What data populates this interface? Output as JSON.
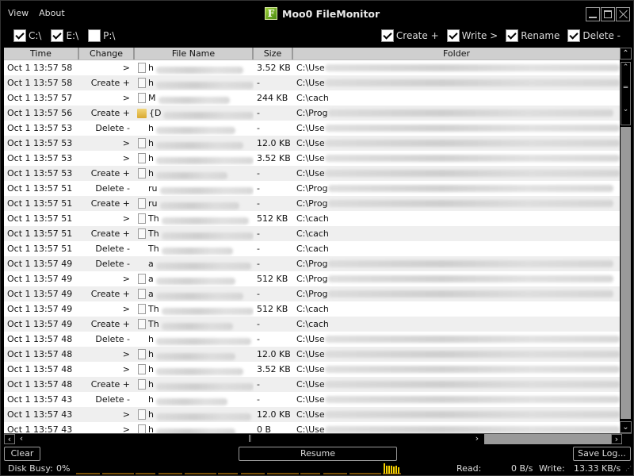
{
  "app": {
    "title": "Moo0 FileMonitor",
    "logo_letter": "F"
  },
  "menu": [
    "View",
    "About"
  ],
  "window_controls": [
    "minimize",
    "maximize",
    "close"
  ],
  "drives": [
    {
      "label": "C:\\",
      "checked": true
    },
    {
      "label": "E:\\",
      "checked": true
    },
    {
      "label": "P:\\",
      "checked": false
    }
  ],
  "event_filters": [
    {
      "label": "Create +",
      "checked": true
    },
    {
      "label": "Write >",
      "checked": true
    },
    {
      "label": "Rename",
      "checked": true
    },
    {
      "label": "Delete -",
      "checked": true
    }
  ],
  "table": {
    "columns": [
      "Time",
      "Change",
      "File Name",
      "Size",
      "Folder"
    ],
    "rows": [
      {
        "time": "Oct 1  13:57 58",
        "change": ">",
        "icon": "file",
        "name": "h",
        "size": "3.52 KB",
        "folder": "C:\\Use"
      },
      {
        "time": "Oct 1  13:57 58",
        "change": "Create +",
        "icon": "file",
        "name": "h",
        "size": "-",
        "folder": "C:\\Use"
      },
      {
        "time": "Oct 1  13:57 57",
        "change": ">",
        "icon": "file",
        "name": "M",
        "size": "244 KB",
        "folder": "C:\\cach"
      },
      {
        "time": "Oct 1  13:57 56",
        "change": "Create +",
        "icon": "folder",
        "name": "{D",
        "size": "-",
        "folder": "C:\\Prog"
      },
      {
        "time": "Oct 1  13:57 53",
        "change": "Delete -",
        "icon": "none",
        "name": "h",
        "size": "-",
        "folder": "C:\\Use"
      },
      {
        "time": "Oct 1  13:57 53",
        "change": ">",
        "icon": "file",
        "name": "h",
        "size": "12.0 KB",
        "folder": "C:\\Use"
      },
      {
        "time": "Oct 1  13:57 53",
        "change": ">",
        "icon": "file",
        "name": "h",
        "size": "3.52 KB",
        "folder": "C:\\Use"
      },
      {
        "time": "Oct 1  13:57 53",
        "change": "Create +",
        "icon": "file",
        "name": "h",
        "size": "-",
        "folder": "C:\\Use"
      },
      {
        "time": "Oct 1  13:57 51",
        "change": "Delete -",
        "icon": "none",
        "name": "ru",
        "size": "-",
        "folder": "C:\\Prog"
      },
      {
        "time": "Oct 1  13:57 51",
        "change": "Create +",
        "icon": "file",
        "name": "ru",
        "size": "-",
        "folder": "C:\\Prog"
      },
      {
        "time": "Oct 1  13:57 51",
        "change": ">",
        "icon": "file",
        "name": "Th",
        "size": "512 KB",
        "folder": "C:\\cach"
      },
      {
        "time": "Oct 1  13:57 51",
        "change": "Create +",
        "icon": "file",
        "name": "Th",
        "size": "-",
        "folder": "C:\\cach"
      },
      {
        "time": "Oct 1  13:57 51",
        "change": "Delete -",
        "icon": "none",
        "name": "Th",
        "size": "-",
        "folder": "C:\\cach"
      },
      {
        "time": "Oct 1  13:57 49",
        "change": "Delete -",
        "icon": "none",
        "name": "a",
        "size": "-",
        "folder": "C:\\Prog"
      },
      {
        "time": "Oct 1  13:57 49",
        "change": ">",
        "icon": "file",
        "name": "a",
        "size": "512 KB",
        "folder": "C:\\Prog"
      },
      {
        "time": "Oct 1  13:57 49",
        "change": "Create +",
        "icon": "file",
        "name": "a",
        "size": "-",
        "folder": "C:\\Prog"
      },
      {
        "time": "Oct 1  13:57 49",
        "change": ">",
        "icon": "file",
        "name": "Th",
        "size": "512 KB",
        "folder": "C:\\cach"
      },
      {
        "time": "Oct 1  13:57 49",
        "change": "Create +",
        "icon": "file",
        "name": "Th",
        "size": "-",
        "folder": "C:\\cach"
      },
      {
        "time": "Oct 1  13:57 48",
        "change": "Delete -",
        "icon": "none",
        "name": "h",
        "size": "-",
        "folder": "C:\\Use"
      },
      {
        "time": "Oct 1  13:57 48",
        "change": ">",
        "icon": "file",
        "name": "h",
        "size": "12.0 KB",
        "folder": "C:\\Use"
      },
      {
        "time": "Oct 1  13:57 48",
        "change": ">",
        "icon": "file",
        "name": "h",
        "size": "3.52 KB",
        "folder": "C:\\Use"
      },
      {
        "time": "Oct 1  13:57 48",
        "change": "Create +",
        "icon": "file",
        "name": "h",
        "size": "-",
        "folder": "C:\\Use"
      },
      {
        "time": "Oct 1  13:57 43",
        "change": "Delete -",
        "icon": "none",
        "name": "h",
        "size": "-",
        "folder": "C:\\Use"
      },
      {
        "time": "Oct 1  13:57 43",
        "change": ">",
        "icon": "file",
        "name": "h",
        "size": "12.0 KB",
        "folder": "C:\\Use"
      },
      {
        "time": "Oct 1  13:57 43",
        "change": ">",
        "icon": "file",
        "name": "h",
        "size": "0 B",
        "folder": "C:\\Use"
      }
    ]
  },
  "buttons": {
    "clear": "Clear",
    "resume": "Resume",
    "save_log": "Save Log..."
  },
  "status": {
    "disk_busy_label": "Disk Busy:",
    "disk_busy_value": "0%",
    "read_label": "Read:",
    "read_value": "0 B/s",
    "write_label": "Write:",
    "write_value": "13.33 KB/s"
  },
  "colors": {
    "activity_graph": "#f0a010",
    "activity_peak": "#f5d000"
  }
}
